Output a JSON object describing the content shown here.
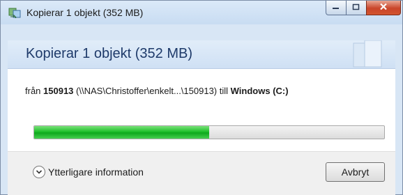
{
  "window": {
    "title": "Kopierar 1 objekt (352 MB)"
  },
  "header": {
    "title": "Kopierar 1 objekt (352 MB)"
  },
  "transfer": {
    "from_word": "från",
    "source_name": "150913",
    "source_path": "(\\\\NAS\\Christoffer\\enkelt...\\150913)",
    "to_word": "till",
    "destination": "Windows (C:)"
  },
  "progress": {
    "fraction": 0.5
  },
  "footer": {
    "more_info_label": "Ytterligare information",
    "cancel_label": "Avbryt"
  },
  "icons": {
    "app": "copy-files-icon",
    "minimize": "minimize-icon",
    "maximize": "maximize-icon",
    "close": "close-icon",
    "expand": "chevron-down-icon"
  },
  "colors": {
    "progress_fill": "#1fbf2b",
    "close_button": "#c9452a",
    "header_text": "#1e3a6a"
  }
}
